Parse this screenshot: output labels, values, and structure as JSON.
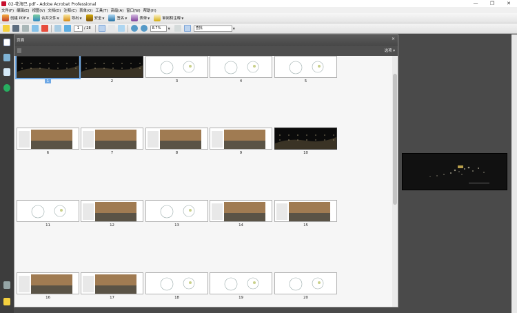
{
  "window": {
    "title": "02-花海已.pdf - Adobe Acrobat Professional",
    "controls": [
      "—",
      "❐",
      "✕"
    ]
  },
  "menu": [
    "文件(F)",
    "编辑(E)",
    "视图(V)",
    "文档(D)",
    "注释(C)",
    "表单(O)",
    "工具(T)",
    "高级(A)",
    "窗口(W)",
    "帮助(H)"
  ],
  "toolbar1": {
    "create_pdf": "创建 PDF",
    "combine": "合并文件",
    "export": "导出",
    "secure": "安全",
    "sign": "签名",
    "forms": "表单",
    "review": "审阅和注释"
  },
  "toolbar2": {
    "current_page": "1",
    "total_pages": "/ 28",
    "zoom": "8.7%",
    "find_placeholder": "查找"
  },
  "panel": {
    "title": "页面",
    "options": "选项",
    "close": "×",
    "thumbnails": [
      {
        "num": "1",
        "style": "dark",
        "selected": true
      },
      {
        "num": "2",
        "style": "dark"
      },
      {
        "num": "3",
        "style": "light"
      },
      {
        "num": "4",
        "style": "light"
      },
      {
        "num": "5",
        "style": "light"
      },
      {
        "num": "6",
        "style": "photo"
      },
      {
        "num": "7",
        "style": "photo"
      },
      {
        "num": "8",
        "style": "photo"
      },
      {
        "num": "9",
        "style": "photo"
      },
      {
        "num": "10",
        "style": "dark"
      },
      {
        "num": "11",
        "style": "light"
      },
      {
        "num": "12",
        "style": "photo"
      },
      {
        "num": "13",
        "style": "light"
      },
      {
        "num": "14",
        "style": "photo"
      },
      {
        "num": "15",
        "style": "photo"
      },
      {
        "num": "16",
        "style": "photo"
      },
      {
        "num": "17",
        "style": "photo"
      },
      {
        "num": "18",
        "style": "light"
      },
      {
        "num": "19",
        "style": "light"
      },
      {
        "num": "20",
        "style": "light"
      }
    ]
  },
  "colors": {
    "selection": "#6fa9e6",
    "chrome_dark": "#4a4a4a",
    "panel_bg": "#f6f6f6"
  }
}
